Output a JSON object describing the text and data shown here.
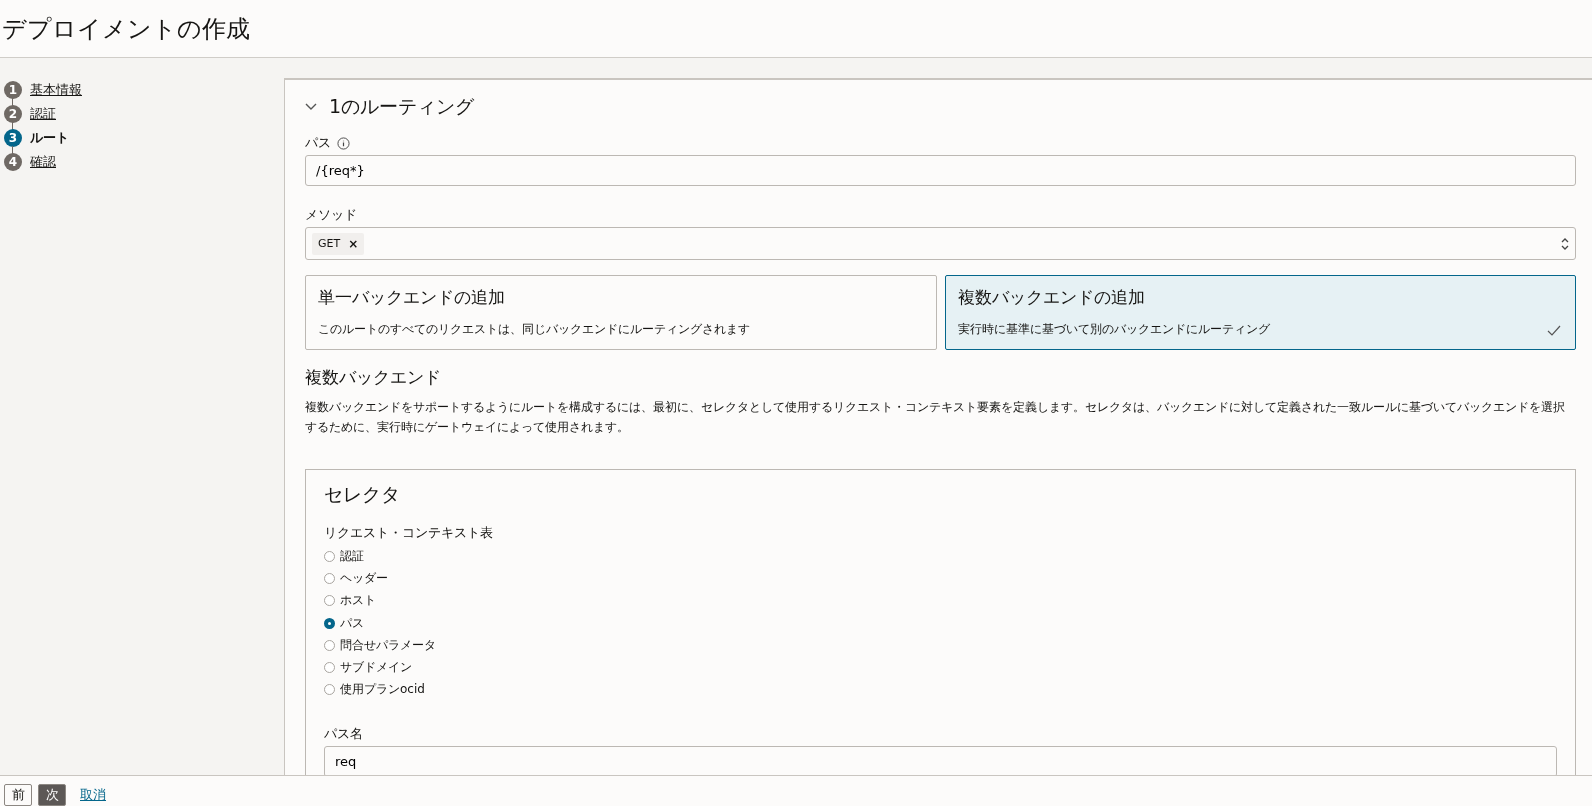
{
  "page_title": "デプロイメントの作成",
  "steps": [
    {
      "number": "1",
      "label": "基本情報",
      "selected": false
    },
    {
      "number": "2",
      "label": "認証",
      "selected": false
    },
    {
      "number": "3",
      "label": "ルート",
      "selected": true
    },
    {
      "number": "4",
      "label": "確認",
      "selected": false
    }
  ],
  "route": {
    "title": "1のルーティング",
    "expanded": true,
    "path": {
      "label": "パス",
      "value": "/{req*}"
    },
    "method": {
      "label": "メソッド",
      "chips": [
        "GET"
      ],
      "chip_remove": "×"
    },
    "backend_options": [
      {
        "title": "単一バックエンドの追加",
        "description": "このルートのすべてのリクエストは、同じバックエンドにルーティングされます",
        "selected": false
      },
      {
        "title": "複数バックエンドの追加",
        "description": "実行時に基準に基づいて別のバックエンドにルーティング",
        "selected": true
      }
    ],
    "section_title": "複数バックエンド",
    "section_text": "複数バックエンドをサポートするようにルートを構成するには、最初に、セレクタとして使用するリクエスト・コンテキスト要素を定義します。セレクタは、バックエンドに対して定義された一致ルールに基づいてバックエンドを選択するために、実行時にゲートウェイによって使用されます。",
    "selector": {
      "title": "セレクタ",
      "table_label": "リクエスト・コンテキスト表",
      "options": [
        {
          "label": "認証",
          "selected": false
        },
        {
          "label": "ヘッダー",
          "selected": false
        },
        {
          "label": "ホスト",
          "selected": false
        },
        {
          "label": "パス",
          "selected": true
        },
        {
          "label": "問合せパラメータ",
          "selected": false
        },
        {
          "label": "サブドメイン",
          "selected": false
        },
        {
          "label": "使用プランocid",
          "selected": false
        }
      ],
      "name_label": "パス名",
      "name_value": "req"
    }
  },
  "footer": {
    "buttons": [
      {
        "label": "前",
        "kind": "secondary"
      },
      {
        "label": "次",
        "kind": "primary"
      },
      {
        "label": "取消",
        "kind": "link"
      }
    ]
  }
}
